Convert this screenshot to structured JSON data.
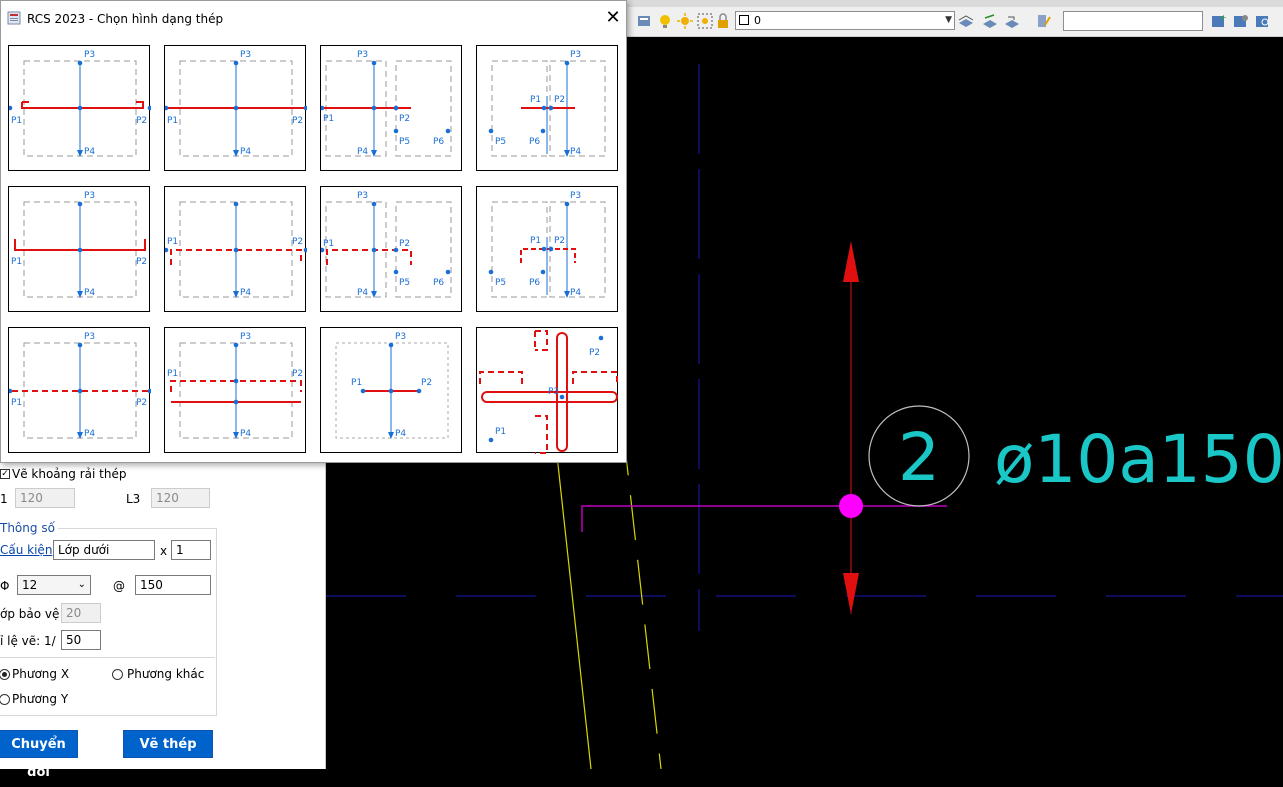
{
  "dialog": {
    "title": "RCS 2023 - Chọn hình dạng thép",
    "close_label": "✕",
    "labels": {
      "p1": "P1",
      "p2": "P2",
      "p3": "P3",
      "p4": "P4",
      "p5": "P5",
      "p6": "P6"
    }
  },
  "toolbar": {
    "layer_value": "0"
  },
  "panel": {
    "checkbox_label": "Vẽ khoảng rải thép",
    "l_label": "1",
    "l_value": "120",
    "l3_label": "L3",
    "l3_value": "120",
    "group_title": "Thông số",
    "cau_kien_link": "Cấu kiện",
    "cau_kien_value": "Lớp dưới",
    "x_label": "x",
    "x_value": "1",
    "phi_label": "Φ",
    "phi_value": "12",
    "at_label": "@",
    "at_value": "150",
    "cover_label": "ớp bảo vệ",
    "cover_value": "20",
    "scale_label": "ỉ lệ vẽ:",
    "scale_prefix": "1/",
    "scale_value": "50",
    "radio_x": "Phương X",
    "radio_other": "Phương khác",
    "radio_y": "Phương Y",
    "convert_button": "Chuyển đổi",
    "draw_button": "Vẽ thép"
  },
  "cad": {
    "bar_number": "2",
    "bar_label": "ø10a150"
  },
  "colors": {
    "accent": "#0063cc",
    "rebar": "#e01010",
    "label_blue": "#1a6fd6",
    "cad_cyan": "#1ac6c6",
    "cad_magenta": "#e000e0"
  }
}
